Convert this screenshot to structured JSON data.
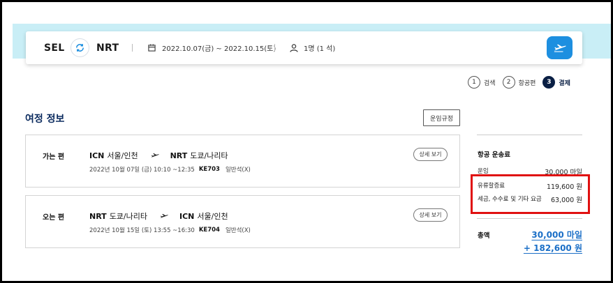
{
  "search": {
    "origin": "SEL",
    "destination": "NRT",
    "dates": "2022.10.07(금) ~ 2022.10.15(토)",
    "passengers": "1명 (1 석)"
  },
  "steps": [
    {
      "num": "1",
      "label": "검색",
      "active": false
    },
    {
      "num": "2",
      "label": "항공편",
      "active": false
    },
    {
      "num": "3",
      "label": "결제",
      "active": true
    }
  ],
  "itinerary": {
    "title": "여정 정보",
    "rules_button": "운임규정",
    "flights": [
      {
        "label": "가는 편",
        "from_code": "ICN",
        "from_city": "서울/인천",
        "to_code": "NRT",
        "to_city": "도쿄/나리타",
        "datetime": "2022년 10월 07일 (금) 10:10 ~12:35",
        "flight_no": "KE703",
        "cabin": "일반석(X)",
        "detail_button": "상세 보기"
      },
      {
        "label": "오는 편",
        "from_code": "NRT",
        "from_city": "도쿄/나리타",
        "to_code": "ICN",
        "to_city": "서울/인천",
        "datetime": "2022년 10월 15일 (토) 13:55 ~16:30",
        "flight_no": "KE704",
        "cabin": "일반석(X)",
        "detail_button": "상세 보기"
      }
    ]
  },
  "fare": {
    "title": "항공 운송료",
    "rows": [
      {
        "label": "운임",
        "value": "30,000 마일"
      },
      {
        "label": "유류할증료",
        "value": "119,600 원"
      },
      {
        "label": "세금, 수수료 및 기타 요금",
        "value": "63,000 원"
      }
    ],
    "total_label": "총액",
    "total_miles": "30,000 마일",
    "total_won": "+ 182,600 원"
  },
  "colors": {
    "brand_blue": "#1d8fe0",
    "navy": "#0a1f44",
    "total_blue": "#1b6fc7",
    "highlight_red": "#e01010",
    "hero_band": "#c9eef6"
  }
}
